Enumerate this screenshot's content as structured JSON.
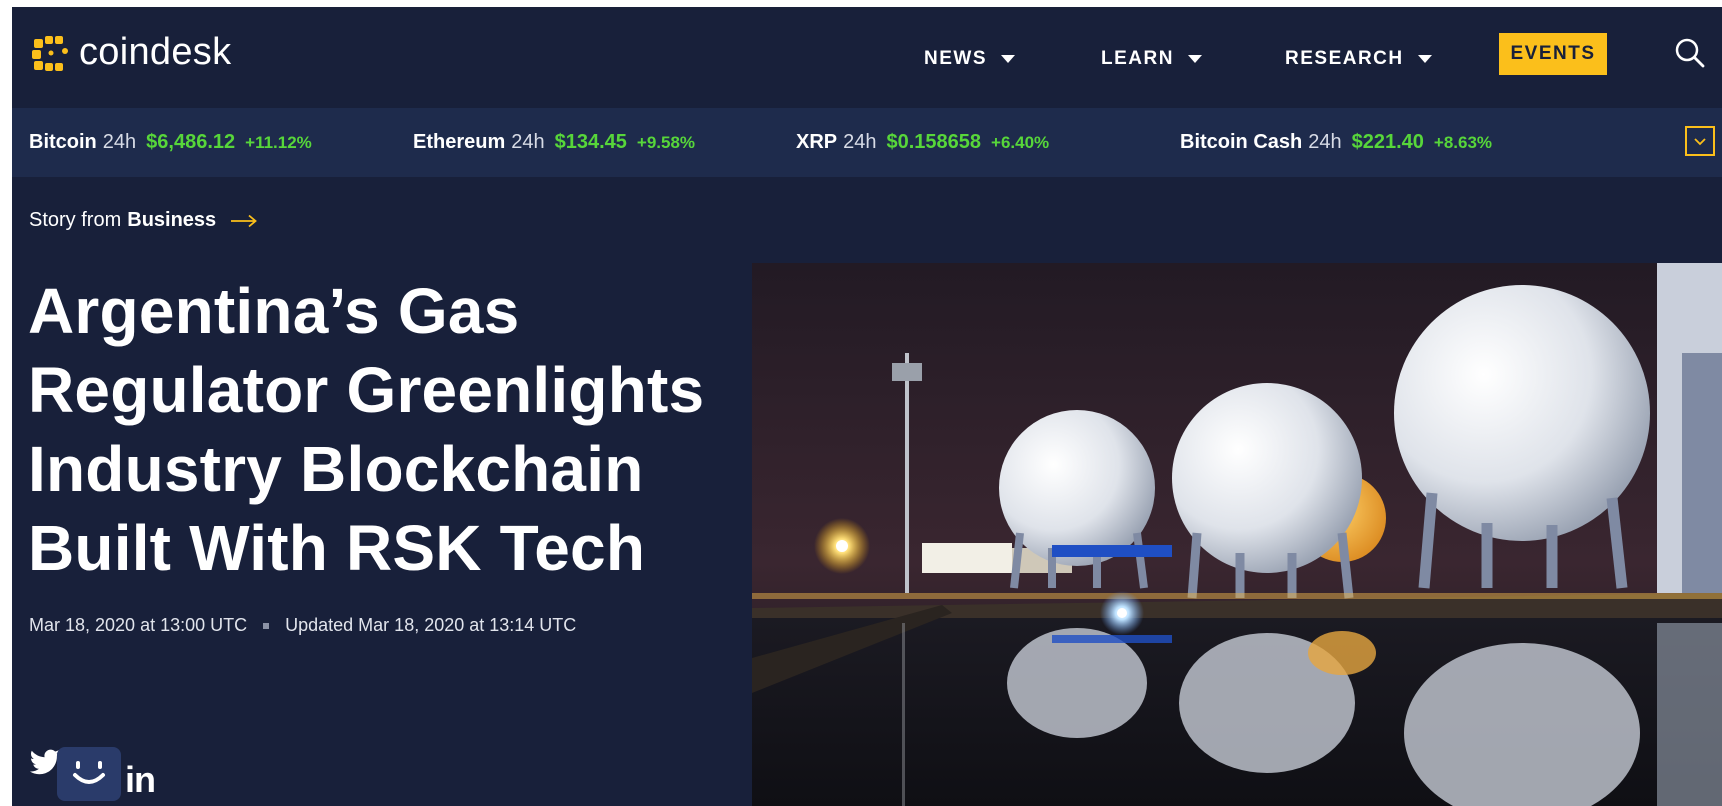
{
  "brand": {
    "name": "coindesk",
    "accent": "#fbbf1b",
    "background": "#18203a",
    "ticker_bg": "#1e2b4c",
    "positive": "#57d63a"
  },
  "nav": {
    "items": [
      {
        "label": "NEWS"
      },
      {
        "label": "LEARN"
      },
      {
        "label": "RESEARCH"
      }
    ],
    "events_label": "EVENTS",
    "search_icon": "search-icon"
  },
  "ticker": [
    {
      "name": "Bitcoin",
      "period": "24h",
      "price": "$6,486.12",
      "change": "+11.12%"
    },
    {
      "name": "Ethereum",
      "period": "24h",
      "price": "$134.45",
      "change": "+9.58%"
    },
    {
      "name": "XRP",
      "period": "24h",
      "price": "$0.158658",
      "change": "+6.40%"
    },
    {
      "name": "Bitcoin Cash",
      "period": "24h",
      "price": "$221.40",
      "change": "+8.63%"
    }
  ],
  "article": {
    "story_prefix": "Story from",
    "category": "Business",
    "headline": "Argentina’s Gas Regulator Greenlights Industry Blockchain Built With RSK Tech",
    "published": "Mar 18, 2020 at 13:00 UTC",
    "updated": "Updated Mar 18, 2020 at 13:14 UTC"
  },
  "social": {
    "linkedin_label": "in"
  }
}
